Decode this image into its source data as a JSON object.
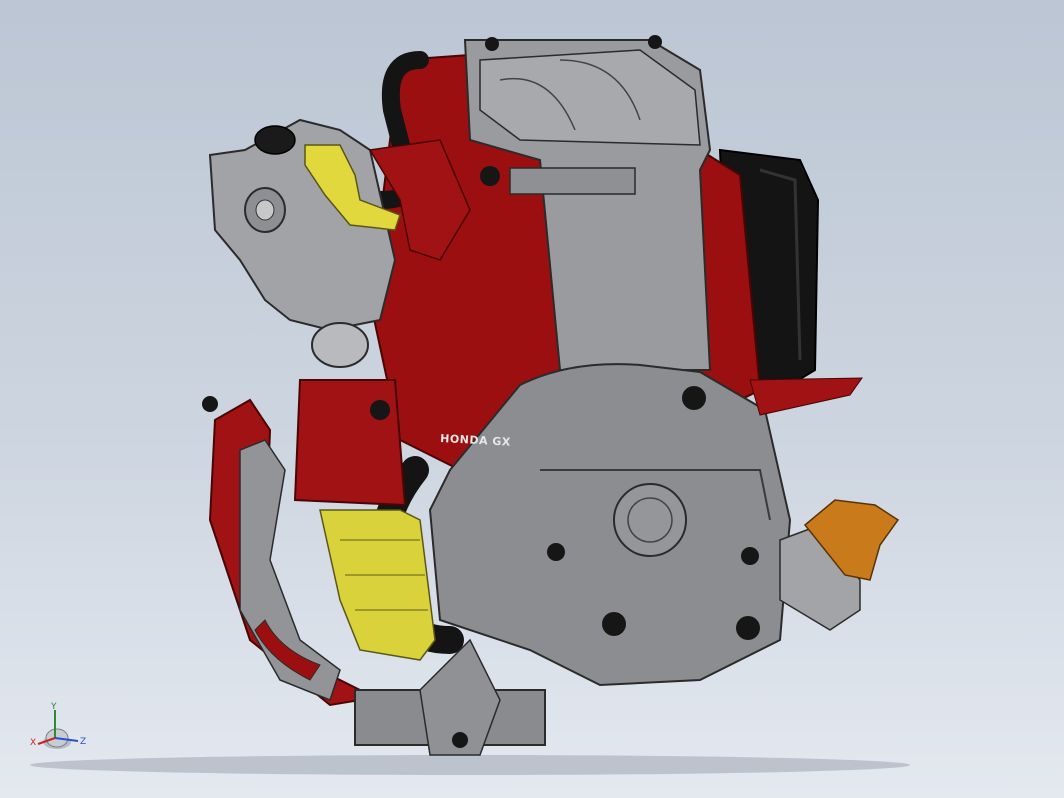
{
  "viewport": {
    "background_top": "#bcc6d4",
    "background_bottom": "#e4e9f0"
  },
  "model": {
    "brand_label": "HONDA GX",
    "colors": {
      "gray_body": "#8c8d90",
      "gray_light": "#a9aaad",
      "red_shroud": "#9c0f10",
      "black_hose": "#141414",
      "yellow_part": "#d9d23a",
      "orange_part": "#c97a1a"
    }
  },
  "triad": {
    "axes": [
      {
        "label": "Y",
        "color": "#2e8b2e"
      },
      {
        "label": "X",
        "color": "#cc2222"
      },
      {
        "label": "Z",
        "color": "#2a4fd0"
      }
    ]
  }
}
